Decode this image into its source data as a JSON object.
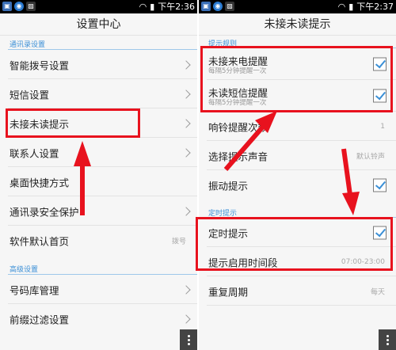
{
  "left_screen": {
    "status_time": "下午2:36",
    "title": "设置中心",
    "section1": "通讯录设置",
    "items_section1": [
      {
        "label": "智能拨号设置",
        "value": ""
      },
      {
        "label": "短信设置",
        "value": ""
      },
      {
        "label": "未接未读提示",
        "value": ""
      },
      {
        "label": "联系人设置",
        "value": ""
      },
      {
        "label": "桌面快捷方式",
        "value": ""
      },
      {
        "label": "通讯录安全保护",
        "value": ""
      },
      {
        "label": "软件默认首页",
        "value": "拨号"
      }
    ],
    "section2": "高级设置",
    "items_section2": [
      {
        "label": "号码库管理",
        "value": ""
      },
      {
        "label": "前缀过滤设置",
        "value": ""
      }
    ]
  },
  "right_screen": {
    "status_time": "下午2:37",
    "title": "未接未读提示",
    "section1": "提示规则",
    "missed_call": {
      "label": "未接来电提醒",
      "sub": "每隔5分钟提醒一次",
      "checked": true
    },
    "unread_sms": {
      "label": "未读短信提醒",
      "sub": "每隔5分钟提醒一次",
      "checked": true
    },
    "ring_count": {
      "label": "响铃提醒次数",
      "value": "1"
    },
    "sound": {
      "label": "选择提示声音",
      "value": "默认铃声"
    },
    "vibrate": {
      "label": "振动提示",
      "checked": true
    },
    "section2": "定时提示",
    "timed": {
      "label": "定时提示",
      "checked": true
    },
    "period": {
      "label": "提示启用时间段",
      "value": "07:00-23:00"
    },
    "repeat": {
      "label": "重复周期",
      "value": "每天"
    }
  },
  "colors": {
    "accent": "#3a8fd6",
    "highlight": "#e8121e"
  }
}
